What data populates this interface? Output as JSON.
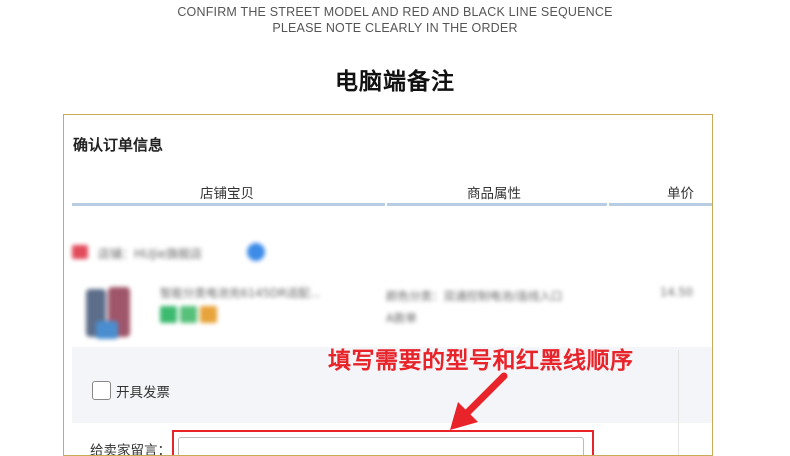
{
  "header": {
    "caption_line1": "CONFIRM THE STREET MODEL AND RED AND BLACK LINE SEQUENCE",
    "caption_line2": "PLEASE NOTE CLEARLY IN THE ORDER",
    "title": "电脑端备注"
  },
  "panel": {
    "title": "确认订单信息",
    "columns": [
      "店铺宝贝",
      "商品属性",
      "单价"
    ],
    "shop": {
      "name": "店铺：HUJie旗舰店",
      "tag_color": "#e24b5b",
      "badge_color": "#3d8be8"
    },
    "product": {
      "title": "智能分类电池充6145DR适配...",
      "tag_colors": [
        "#3cba6f",
        "#57c07a",
        "#e8a33a"
      ],
      "attributes": [
        "颜色分类：双通控制电池/连线入口",
        "A款单"
      ],
      "price": "14.50"
    },
    "invoice": {
      "label": "开具发票",
      "checked": false
    },
    "message": {
      "label": "给卖家留言：",
      "value": ""
    }
  },
  "annotation": {
    "text": "填写需要的型号和红黑线顺序",
    "color": "#e8232a"
  },
  "colors": {
    "border_gold": "#c9a95a",
    "column_underline": "#b8cce4",
    "highlight_red": "#e8232a"
  }
}
